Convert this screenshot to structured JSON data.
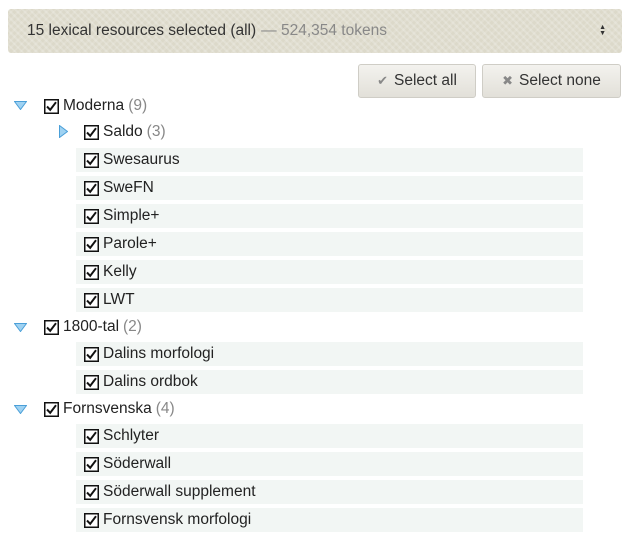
{
  "header": {
    "summary": "15 lexical resources selected (all)",
    "tokens": "— 524,354 tokens",
    "updown_icon": "updown-arrows-icon"
  },
  "buttons": {
    "select_all": "Select all",
    "select_none": "Select none"
  },
  "colors": {
    "accent": "#4a9fd8",
    "bar_bg": "#dcd9ca",
    "row_bg": "#f2f6f4"
  },
  "groups": [
    {
      "label": "Moderna",
      "count": "(9)",
      "expanded": true,
      "checked": true,
      "children": [
        {
          "label": "Saldo",
          "count": "(3)",
          "checked": true,
          "collapsed_group": true
        },
        {
          "label": "Swesaurus",
          "checked": true
        },
        {
          "label": "SweFN",
          "checked": true
        },
        {
          "label": "Simple+",
          "checked": true
        },
        {
          "label": "Parole+",
          "checked": true
        },
        {
          "label": "Kelly",
          "checked": true
        },
        {
          "label": "LWT",
          "checked": true
        }
      ]
    },
    {
      "label": "1800-tal",
      "count": "(2)",
      "expanded": true,
      "checked": true,
      "children": [
        {
          "label": "Dalins morfologi",
          "checked": true
        },
        {
          "label": "Dalins ordbok",
          "checked": true
        }
      ]
    },
    {
      "label": "Fornsvenska",
      "count": "(4)",
      "expanded": true,
      "checked": true,
      "children": [
        {
          "label": "Schlyter",
          "checked": true
        },
        {
          "label": "Söderwall",
          "checked": true
        },
        {
          "label": "Söderwall supplement",
          "checked": true
        },
        {
          "label": "Fornsvensk morfologi",
          "checked": true
        }
      ]
    }
  ]
}
